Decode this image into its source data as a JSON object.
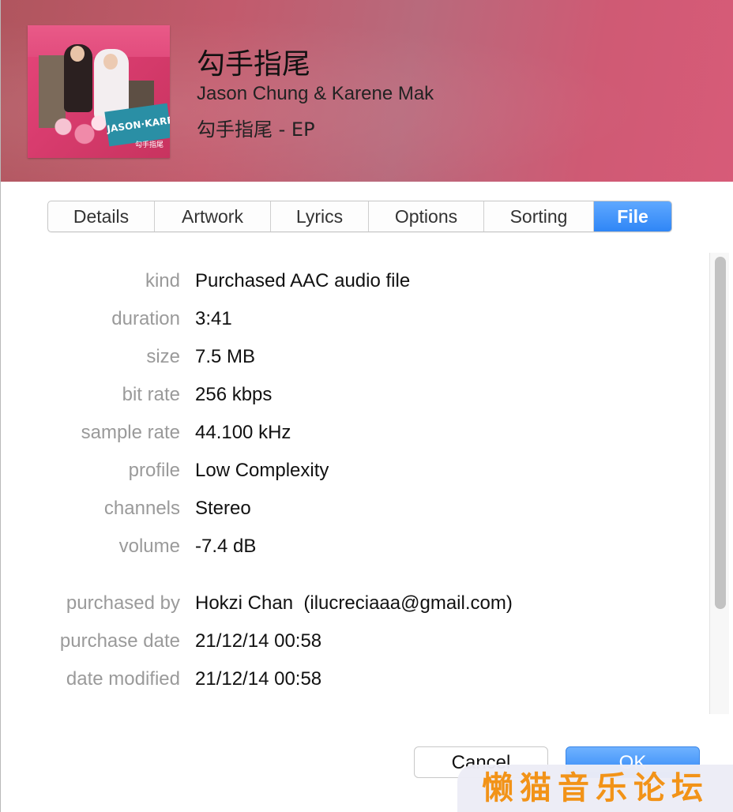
{
  "header": {
    "title": "勾手指尾",
    "artist": "Jason Chung & Karene Mak",
    "album": "勾手指尾 - EP",
    "artwork_text": "JASON·KARENE",
    "artwork_subtext": "勾手指尾"
  },
  "tabs": [
    {
      "label": "Details",
      "active": false
    },
    {
      "label": "Artwork",
      "active": false
    },
    {
      "label": "Lyrics",
      "active": false
    },
    {
      "label": "Options",
      "active": false
    },
    {
      "label": "Sorting",
      "active": false
    },
    {
      "label": "File",
      "active": true
    }
  ],
  "file_info": [
    {
      "label": "kind",
      "value": "Purchased AAC audio file"
    },
    {
      "label": "duration",
      "value": "3:41"
    },
    {
      "label": "size",
      "value": "7.5 MB"
    },
    {
      "label": "bit rate",
      "value": "256 kbps"
    },
    {
      "label": "sample rate",
      "value": "44.100 kHz"
    },
    {
      "label": "profile",
      "value": "Low Complexity"
    },
    {
      "label": "channels",
      "value": "Stereo"
    },
    {
      "label": "volume",
      "value": "-7.4 dB"
    },
    {
      "label": "purchased by",
      "value": "Hokzi Chan  (ilucreciaaa@gmail.com)"
    },
    {
      "label": "purchase date",
      "value": "21/12/14 00:58"
    },
    {
      "label": "date modified",
      "value": "21/12/14 00:58"
    }
  ],
  "buttons": {
    "cancel": "Cancel",
    "ok": "OK"
  },
  "watermark": "懒猫音乐论坛",
  "colors": {
    "accent": "#2f86f6",
    "header": "#c25a6c",
    "watermark": "#f29318"
  }
}
